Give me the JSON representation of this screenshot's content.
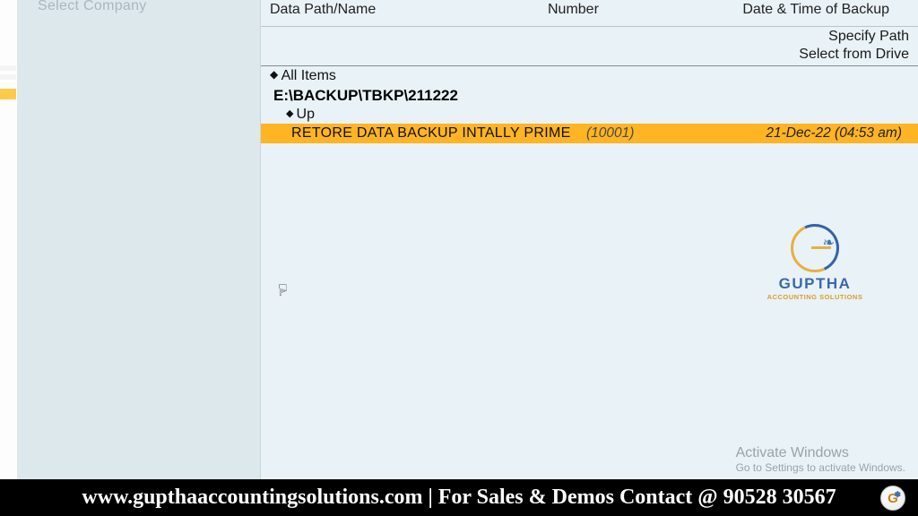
{
  "sidebar": {
    "dim_label": "Select Company"
  },
  "headers": {
    "path": "Data Path/Name",
    "number": "Number",
    "date": "Date & Time of Backup"
  },
  "actions": {
    "specify_path": "Specify Path",
    "select_drive": "Select from Drive"
  },
  "list": {
    "all_items": "All Items",
    "current_path": "E:\\BACKUP\\TBKP\\211222",
    "up": "Up",
    "selected": {
      "name": "RETORE DATA BACKUP INTALLY PRIME",
      "number": "(10001)",
      "date": "21-Dec-22 (04:53 am)"
    }
  },
  "watermark": {
    "name": "GUPTHA",
    "sub": "ACCOUNTING SOLUTIONS"
  },
  "activate": {
    "title": "Activate Windows",
    "sub": "Go to Settings to activate Windows."
  },
  "banner": {
    "text": "www.gupthaaccountingsolutions.com | For Sales & Demos Contact @ 90528 30567"
  }
}
